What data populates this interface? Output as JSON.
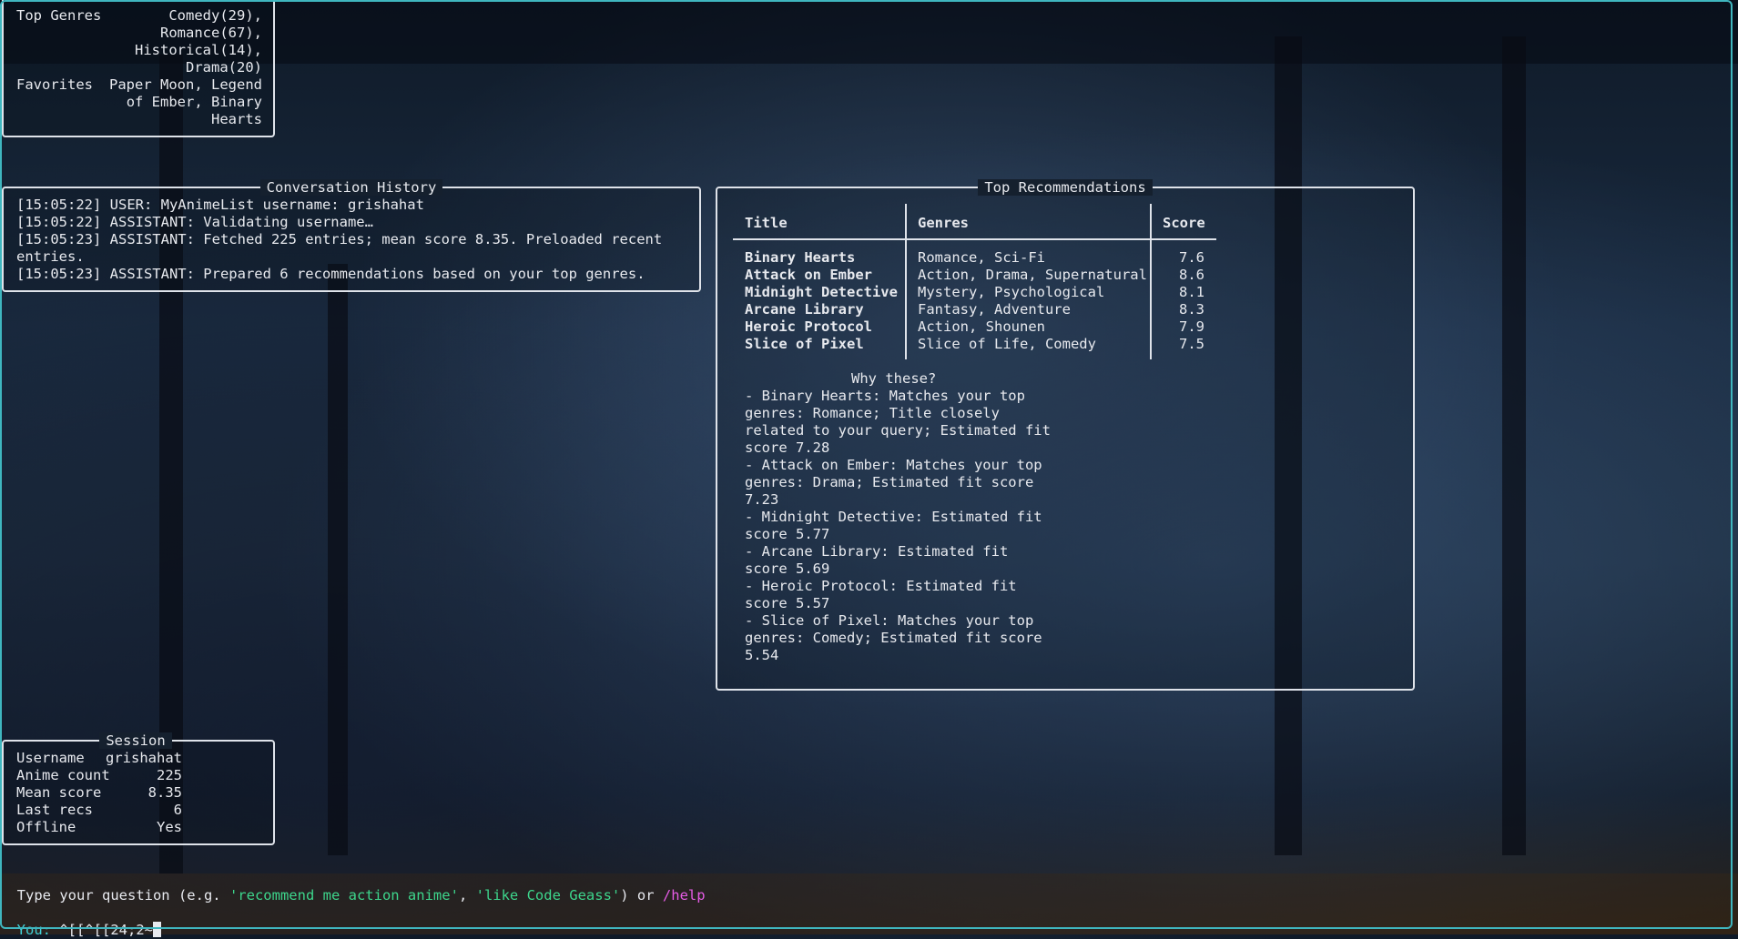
{
  "profile": {
    "top_genres_label": "Top Genres",
    "top_genres_lines": [
      "Comedy(29),",
      "Romance(67),",
      "Historical(14),",
      "Drama(20)"
    ],
    "favorites_label": "Favorites",
    "favorites_lines": [
      "Paper Moon, Legend",
      "of Ember, Binary",
      "Hearts"
    ]
  },
  "conversation": {
    "title": "Conversation History",
    "lines": [
      "[15:05:22] USER: MyAnimeList username: grishahat",
      "[15:05:22] ASSISTANT: Validating username…",
      "[15:05:23] ASSISTANT: Fetched 225 entries; mean score 8.35. Preloaded recent",
      "entries.",
      "[15:05:23] ASSISTANT: Prepared 6 recommendations based on your top genres."
    ]
  },
  "recommendations": {
    "title": "Top Recommendations",
    "headers": {
      "title": "Title",
      "genres": "Genres",
      "score": "Score"
    },
    "rows": [
      {
        "title": "Binary Hearts",
        "genres": "Romance, Sci-Fi",
        "score": "7.6"
      },
      {
        "title": "Attack on Ember",
        "genres": "Action, Drama, Supernatural",
        "score": "8.6"
      },
      {
        "title": "Midnight Detective",
        "genres": "Mystery, Psychological",
        "score": "8.1"
      },
      {
        "title": "Arcane Library",
        "genres": "Fantasy, Adventure",
        "score": "8.3"
      },
      {
        "title": "Heroic Protocol",
        "genres": "Action, Shounen",
        "score": "7.9"
      },
      {
        "title": "Slice of Pixel",
        "genres": "Slice of Life, Comedy",
        "score": "7.5"
      }
    ],
    "why_title": "Why these?",
    "why_lines": [
      "- Binary Hearts: Matches your top",
      "genres: Romance; Title closely",
      "related to your query; Estimated fit",
      "score 7.28",
      "- Attack on Ember: Matches your top",
      "genres: Drama; Estimated fit score",
      "7.23",
      "- Midnight Detective: Estimated fit",
      "score 5.77",
      "- Arcane Library: Estimated fit",
      "score 5.69",
      "- Heroic Protocol: Estimated fit",
      "score 5.57",
      "- Slice of Pixel: Matches your top",
      "genres: Comedy; Estimated fit score",
      "5.54"
    ]
  },
  "session": {
    "title": "Session",
    "rows": [
      {
        "label": "Username",
        "value": "grishahat"
      },
      {
        "label": "Anime count",
        "value": "225"
      },
      {
        "label": "Mean score",
        "value": "8.35"
      },
      {
        "label": "Last recs",
        "value": "6"
      },
      {
        "label": "Offline",
        "value": "Yes"
      }
    ]
  },
  "prompt": {
    "hint_prefix": "Type your question (e.g. ",
    "example1": "'recommend me action anime'",
    "sep": ", ",
    "example2": "'like Code Geass'",
    "hint_mid": ") or ",
    "help_cmd": "/help",
    "you_label": "You:",
    "input_value": " ^[[^[[24;2~"
  }
}
